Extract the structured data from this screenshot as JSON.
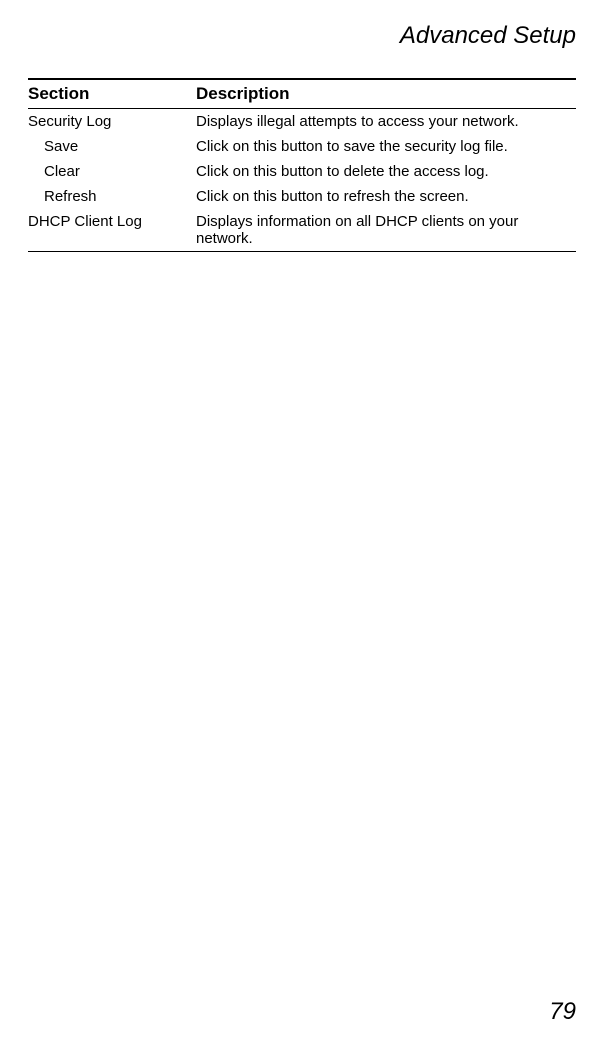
{
  "header": {
    "title": "Advanced Setup"
  },
  "table": {
    "columns": {
      "section": "Section",
      "description": "Description"
    },
    "rows": [
      {
        "section": "Security Log",
        "description": "Displays illegal attempts to access your network.",
        "indent": false
      },
      {
        "section": "Save",
        "description": "Click on this button to save the security log file.",
        "indent": true
      },
      {
        "section": "Clear",
        "description": "Click on this button to delete the access log.",
        "indent": true
      },
      {
        "section": "Refresh",
        "description": "Click on this button to refresh the screen.",
        "indent": true
      },
      {
        "section": "DHCP Client Log",
        "description": "Displays information on all DHCP clients on your network.",
        "indent": false
      }
    ]
  },
  "footer": {
    "page_number": "79"
  }
}
